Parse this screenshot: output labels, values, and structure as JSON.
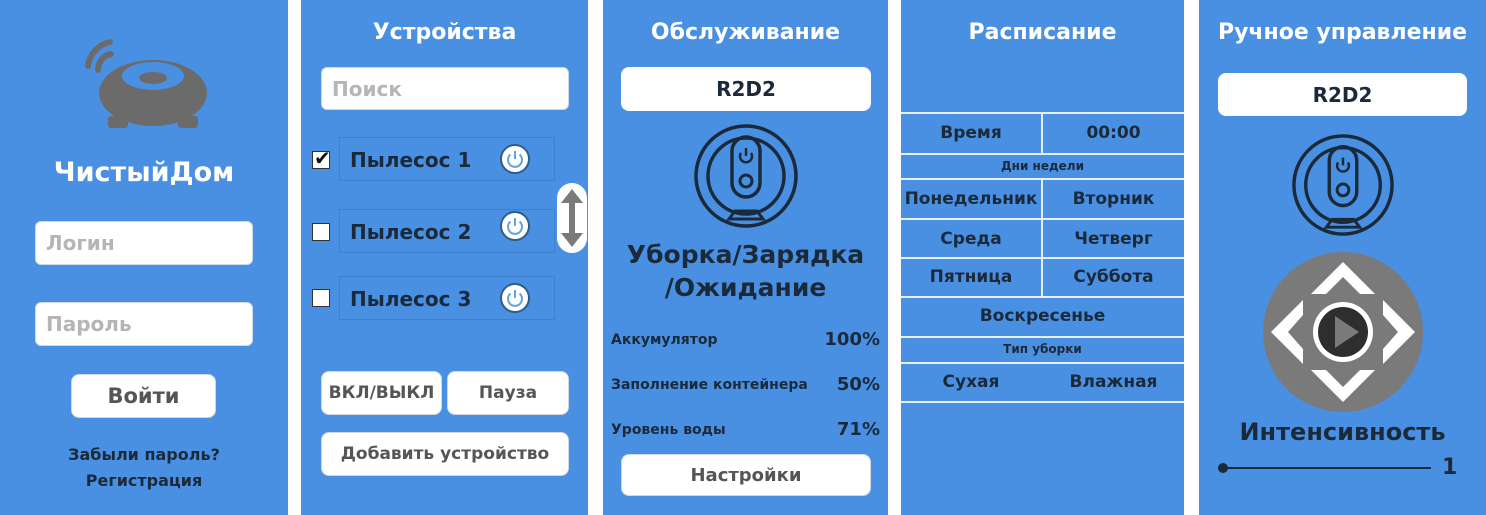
{
  "login": {
    "app_name": "ЧистыйДом",
    "login_placeholder": "Логин",
    "password_placeholder": "Пароль",
    "submit_label": "Войти",
    "forgot_link": "Забыли пароль?",
    "register_link": "Регистрация"
  },
  "devices": {
    "title": "Устройства",
    "search_placeholder": "Поиск",
    "items": [
      {
        "label": "Пылесос 1",
        "checked": true
      },
      {
        "label": "Пылесос 2",
        "checked": false
      },
      {
        "label": "Пылесос 3",
        "checked": false
      }
    ],
    "power_toggle_label": "ВКЛ/ВЫКЛ",
    "pause_label": "Пауза",
    "add_device_label": "Добавить устройство"
  },
  "service": {
    "title": "Обслуживание",
    "device_name": "R2D2",
    "status_line1": "Уборка/Зарядка",
    "status_line2": "/Ожидание",
    "stats": [
      {
        "label": "Аккумулятор",
        "value": "100%"
      },
      {
        "label": "Заполнение контейнера",
        "value": "50%"
      },
      {
        "label": "Уровень воды",
        "value": "71%"
      }
    ],
    "settings_label": "Настройки"
  },
  "schedule": {
    "title": "Расписание",
    "time_label": "Время",
    "time_value": "00:00",
    "weekdays_header": "Дни недели",
    "days": [
      "Понедельник",
      "Вторник",
      "Среда",
      "Четверг",
      "Пятница",
      "Суббота",
      "Воскресенье"
    ],
    "cleaning_type_header": "Тип уборки",
    "cleaning_types": [
      "Сухая",
      "Влажная"
    ]
  },
  "manual": {
    "title": "Ручное управление",
    "device_name": "R2D2",
    "intensity_label": "Интенсивность",
    "intensity_value": "1"
  },
  "colors": {
    "panel_bg": "#4a90e2",
    "text_dark": "#1b2a3a",
    "robot_gray": "#6b6b6b"
  },
  "icons": [
    "robot-vacuum-icon",
    "wifi-signal-icon",
    "power-icon",
    "checkmark-icon",
    "scroll-arrows-icon",
    "robot-vacuum-outline-icon",
    "direction-pad-icon",
    "play-icon"
  ]
}
